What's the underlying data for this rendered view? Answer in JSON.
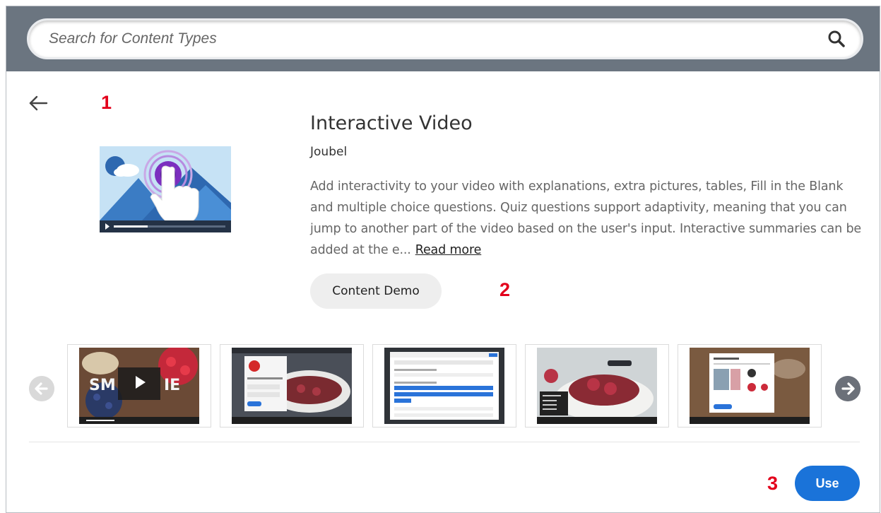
{
  "search": {
    "placeholder": "Search for Content Types"
  },
  "callouts": {
    "one": "1",
    "two": "2",
    "three": "3"
  },
  "content_type": {
    "title": "Interactive Video",
    "author": "Joubel",
    "description": "Add interactivity to your video with explanations, extra pictures, tables, Fill in the Blank and multiple choice questions. Quiz questions support adaptivity, meaning that you can jump to another part of the video based on the user's input. Interactive summaries can be added at the e...",
    "read_more": "Read more"
  },
  "buttons": {
    "demo": "Content Demo",
    "use": "Use"
  },
  "screenshots": {
    "first_overlay_text": "SM",
    "first_overlay_text2": "IE"
  },
  "colors": {
    "header_bg": "#6b7580",
    "use_button": "#1a73d9",
    "callout": "#e3001b"
  }
}
